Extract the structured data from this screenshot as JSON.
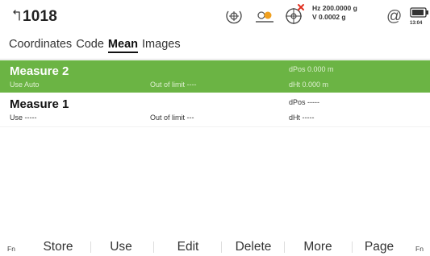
{
  "header": {
    "title": "1018",
    "hz_line": "Hz 200.0000 g",
    "v_line": "V   0.0002 g",
    "at_symbol": "@",
    "battery_time": "13:04",
    "icons": [
      "back-arrow-icon",
      "crosshair-target-icon",
      "prism-icon",
      "gps-satellite-icon",
      "at-icon",
      "battery-icon"
    ],
    "colors": {
      "prism_orange": "#f0a020",
      "gps_red": "#e03020"
    }
  },
  "tabs": [
    {
      "label": "Coordinates",
      "active": false
    },
    {
      "label": "Code",
      "active": false
    },
    {
      "label": "Mean",
      "active": true
    },
    {
      "label": "Images",
      "active": false
    }
  ],
  "rows": [
    {
      "name": "Measure 2",
      "use": "Use  Auto",
      "limit": "Out of limit  ----",
      "dpos": "dPos  0.000 m",
      "dht": "dHt  0.000 m",
      "selected": true
    },
    {
      "name": "Measure 1",
      "use": "Use  -----",
      "limit": "Out of limit  ---",
      "dpos": "dPos  -----",
      "dht": "dHt  -----",
      "selected": false
    }
  ],
  "function_bar": {
    "fn_left": "Fn",
    "fn_right": "Fn",
    "keys": [
      "Store",
      "Use",
      "Edit",
      "Delete",
      "More",
      "Page"
    ]
  },
  "colors": {
    "selected_row": "#6bb444"
  }
}
